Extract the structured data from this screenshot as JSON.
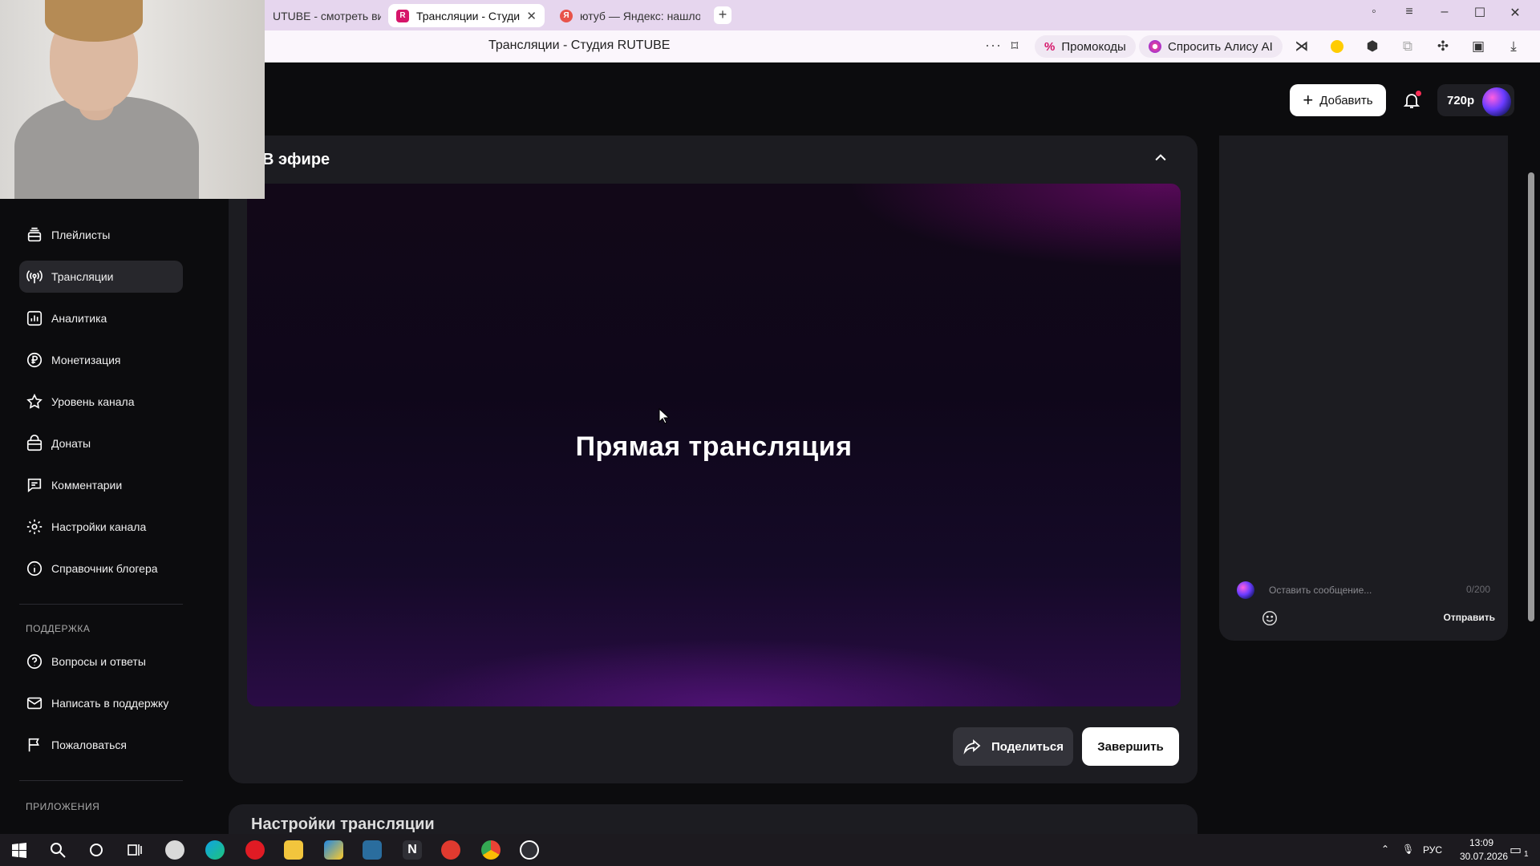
{
  "browser": {
    "tabs": [
      {
        "label": "UTUBE - смотреть виде",
        "active": false
      },
      {
        "label": "Трансляции - Студия R",
        "active": true
      },
      {
        "label": "ютуб — Яндекс: нашлось",
        "active": false
      }
    ],
    "page_title": "Трансляции - Студия RUTUBE",
    "promo_label": "Промокоды",
    "alice_label": "Спросить Алису AI"
  },
  "header": {
    "add_label": "Добавить",
    "quality_label": "720p"
  },
  "sidebar": {
    "items": [
      {
        "label": "Плейлисты",
        "icon": "playlist-icon",
        "active": false
      },
      {
        "label": "Трансляции",
        "icon": "broadcast-icon",
        "active": true
      },
      {
        "label": "Аналитика",
        "icon": "analytics-icon",
        "active": false
      },
      {
        "label": "Монетизация",
        "icon": "ruble-icon",
        "active": false
      },
      {
        "label": "Уровень канала",
        "icon": "star-icon",
        "active": false
      },
      {
        "label": "Донаты",
        "icon": "donate-icon",
        "active": false
      },
      {
        "label": "Комментарии",
        "icon": "comment-icon",
        "active": false
      },
      {
        "label": "Настройки канала",
        "icon": "gear-icon",
        "active": false
      },
      {
        "label": "Справочник блогера",
        "icon": "info-icon",
        "active": false
      }
    ],
    "support_heading": "ПОДДЕРЖКА",
    "support_items": [
      {
        "label": "Вопросы и ответы",
        "icon": "question-icon"
      },
      {
        "label": "Написать в поддержку",
        "icon": "mail-icon"
      },
      {
        "label": "Пожаловаться",
        "icon": "flag-icon"
      }
    ],
    "apps_heading": "ПРИЛОЖЕНИЯ"
  },
  "main": {
    "section_title": "В эфире",
    "video_title": "Прямая трансляция",
    "share_label": "Поделиться",
    "end_label": "Завершить",
    "next_section_title": "Настройки трансляции"
  },
  "chat": {
    "placeholder": "Оставить сообщение...",
    "counter": "0/200",
    "send_label": "Отправить"
  },
  "taskbar": {
    "lang": "РУС",
    "time": "13:09",
    "date": "30.07.2026",
    "notif_count": "1"
  },
  "colors": {
    "accent_bg": "#0c0c0e",
    "panel": "#1c1c21",
    "tabbar": "#e6d6ee"
  }
}
